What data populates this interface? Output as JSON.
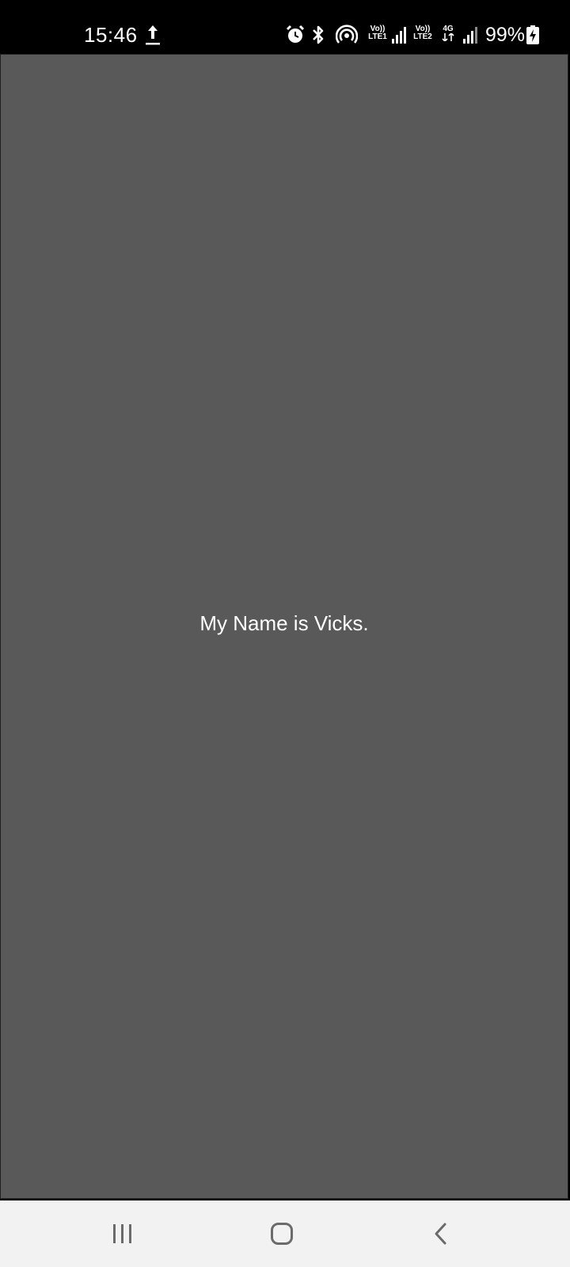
{
  "status_bar": {
    "time": "15:46",
    "sim1_volte": "Vo))",
    "sim1_lte": "LTE1",
    "sim2_volte": "Vo))",
    "sim2_lte": "LTE2",
    "data_type": "4G",
    "battery_percent": "99%",
    "icons": [
      "upload-icon",
      "alarm-icon",
      "bluetooth-icon",
      "hotspot-icon",
      "signal-sim1-icon",
      "signal-sim2-icon",
      "data-arrows-icon",
      "battery-charging-icon"
    ]
  },
  "main": {
    "message": "My Name is Vicks.",
    "background_color": "#595959",
    "text_color": "#ffffff"
  },
  "nav_bar": {
    "buttons": [
      "recent-apps-icon",
      "home-icon",
      "back-icon"
    ],
    "background_color": "#f2f2f2"
  }
}
